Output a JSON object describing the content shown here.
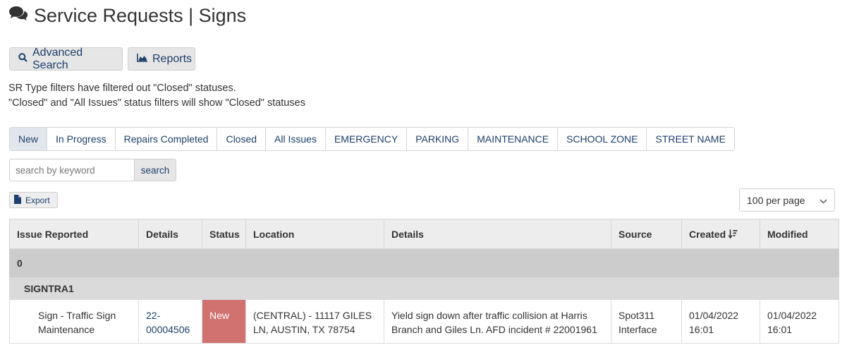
{
  "header": {
    "title": "Service Requests | Signs",
    "icon": "comments-icon"
  },
  "toolbar": {
    "advanced_search_label": "Advanced Search",
    "reports_label": "Reports"
  },
  "notice": {
    "line1": "SR Type filters have filtered out \"Closed\" statuses.",
    "line2": "\"Closed\" and \"All Issues\" status filters will show \"Closed\" statuses"
  },
  "tabs": [
    {
      "label": "New",
      "active": true
    },
    {
      "label": "In Progress"
    },
    {
      "label": "Repairs Completed"
    },
    {
      "label": "Closed"
    },
    {
      "label": "All Issues"
    },
    {
      "label": "EMERGENCY"
    },
    {
      "label": "PARKING"
    },
    {
      "label": "MAINTENANCE"
    },
    {
      "label": "SCHOOL ZONE"
    },
    {
      "label": "STREET NAME"
    }
  ],
  "search": {
    "placeholder": "search by keyword",
    "value": "",
    "button_label": "search"
  },
  "export": {
    "label": "Export"
  },
  "per_page": {
    "selected": "100 per page"
  },
  "table": {
    "headers": [
      "Issue Reported",
      "Details",
      "Status",
      "Location",
      "Details",
      "Source",
      "Created",
      "Modified"
    ],
    "group_label": "0",
    "subgroup_label": "SIGNTRA1",
    "rows": [
      {
        "issue": "Sign - Traffic Sign Maintenance",
        "details_id": "22-00004506",
        "status": "New",
        "location": "(CENTRAL) - 11117 GILES LN, AUSTIN, TX 78754",
        "description": "Yield sign down after traffic collision at Harris Branch and Giles Ln. AFD incident # 22001961",
        "source": "Spot311 Interface",
        "created": "01/04/2022 16:01",
        "modified": "01/04/2022 16:01"
      }
    ]
  },
  "colors": {
    "accent": "#1d3f6b",
    "status_new": "#d17270",
    "header_bg": "#ededed"
  }
}
